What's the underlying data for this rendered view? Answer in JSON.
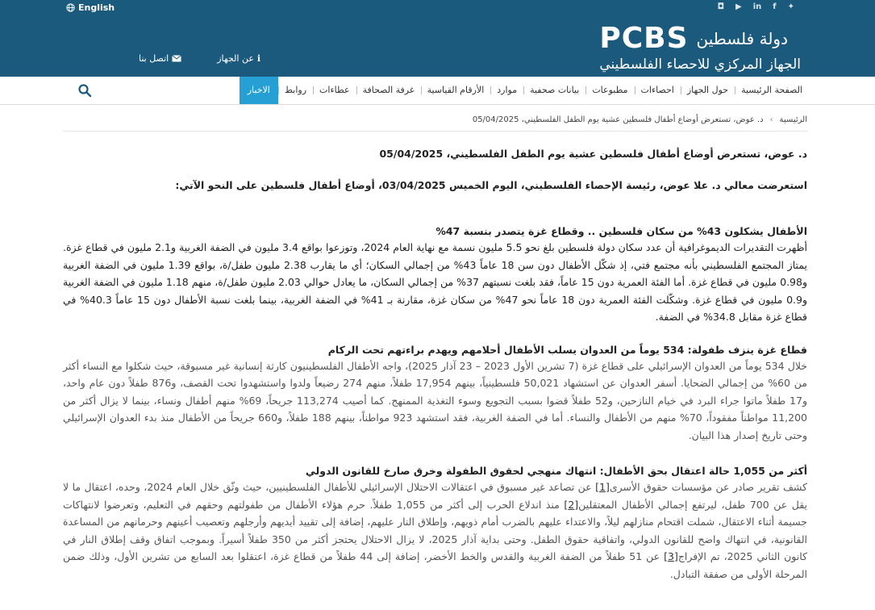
{
  "topbar": {
    "language": "English",
    "social_icons": [
      "twitter-icon",
      "facebook-icon",
      "linkedin-icon",
      "youtube-icon",
      "instagram-icon"
    ]
  },
  "header": {
    "country": "دولة فلسطين",
    "logo_text": "PCBS",
    "subtitle": "الجهاز المركزي للاحصاء الفلسطيني",
    "about": "عن الجهاز",
    "contact": "اتصل بنا"
  },
  "nav": {
    "items": [
      "الصفحة الرئيسية",
      "حول الجهاز",
      "احصاءات",
      "مطبوعات",
      "بيانات صحفية",
      "موارد",
      "الأرقام القياسية",
      "غرفة الصحافة",
      "عطاءات",
      "روابط",
      "الاخبار"
    ],
    "active_color": "#26a0d4"
  },
  "breadcrumb": {
    "home": "الرئيسية",
    "current": "د. عوض، تستعرض أوضاع أطفال فلسطين عشية يوم الطفل الفلسطيني، 05/04/2025"
  },
  "article": {
    "title": "د. عوض، تستعرض أوضاع أطفال فلسطين عشية يوم الطفل الفلسطيني، 05/04/2025",
    "lead": "استعرضت معالي د. علا عوض، رئيسة الإحصاء الفلسطيني، اليوم الخميس 03/04/2025، أوضاع أطفال فلسطين على النحو الآتي:",
    "section1_heading": "الأطفال يشكلون 43% من سكان فلسطين .. وقطاع غزة يتصدر بنسبة 47%",
    "section1_text": "أظهرت التقديرات الديموغرافية أن عدد سكان دولة فلسطين بلغ نحو 5.5 مليون نسمة مع نهاية العام 2024، وتوزعوا بواقع 3.4 مليون في الضفة الغربية و2.1 مليون في قطاع غزة.  يمتاز المجتمع الفلسطيني بأنه مجتمع فتي، إذ شكّل الأطفال دون سن 18 عاماً 43% من إجمالي السكان؛ أي ما يقارب 2.38 مليون طفل/ة،  بواقع 1.39 مليون في الضفة الغربية و0.98 مليون في قطاع غزة.  أما الفئة العمرية دون 15 عاماً، فقد بلغت نسبتهم 37% من إجمالي السكان، ما يعادل حوالي 2.03 مليون طفل/ة، منهم 1.18 مليون في الضفة الغربية و0.9 مليون في قطاع غزة.  وشكّلت الفئة العمرية دون 18 عاماً نحو 47% من سكان غزة،  مقارنة بـ 41% في الضفة الغربية، بينما بلغت نسبة الأطفال دون 15 عاماً 40.3% في قطاع غزة  مقابل 34.8% في الضفة.",
    "section2_heading": "قطاع غزة ينزف طفولة: 534 يوماً من العدوان يسلب الأطفال أحلامهم ويهدم براءتهم تحت الركام",
    "section2_text": "خلال 534 يوماً من العدوان الإسرائيلي على قطاع غزة (7 تشرين الأول 2023 – 23 آذار 2025)،  واجه الأطفال الفلسطينيون كارثة إنسانية غير مسبوقة، حيث شكلوا مع النساء أكثر من 60% من إجمالي الضحايا.  أسفر العدوان عن استشهاد 50,021 فلسطينياً، بينهم 17,954 طفلاً، منهم 274 رضيعاً ولدوا واستشهدوا تحت القصف، و876 طفلاً دون عام واحد، و17 طفلاً ماتوا جراء البرد في خيام النازحين، و52 طفلاً قضوا بسبب التجويع وسوء التغذية الممنهج. كما أصيب 113,274 جريحاً، 69% منهم أطفال ونساء، بينما لا يزال أكثر من 11,200 مواطناً مفقوداً، 70% منهم من الأطفال والنساء.   أما في الضفة الغربية، فقد استشهد 923 مواطناً، بينهم 188 طفلاً، و660 جريحاً  من الأطفال منذ بدء العدوان الإسرائيلي وحتى تاريخ إصدار هذا البيان.",
    "section3_heading": "أكثر من 1,055 حالة اعتقال بحق الأطفال: انتهاك منهجي لحقوق الطفولة وخرق صارخ للقانون الدولي",
    "section3_part1": "كشف تقرير صادر عن مؤسسات حقوق الأسرى",
    "section3_ref1": "[1]",
    "section3_part2": " عن تصاعد غير مسبوق في اعتقالات الاحتلال الإسرائيلي للأطفال الفلسطينيين، حيث وثّق خلال العام 2024، وحده، اعتقال ما لا يقل عن 700 طفل، ليرتفع إجمالي الأطفال المعتقلين",
    "section3_ref2": "[2]",
    "section3_part3": " منذ اندلاع الحرب إلى أكثر من 1,055 طفلاً.  حرم هؤلاء الأطفال من طفولتهم وحقهم في التعليم، وتعرضوا لانتهاكات جسيمة أثناء الاعتقال، شملت اقتحام منازلهم ليلاً، والاعتداء عليهم بالضرب أمام ذويهم، وإطلاق النار عليهم، إضافة إلى تقييد أيديهم وأرجلهم وتعصيب أعينهم وحرمانهم من المساعدة القانونية، في انتهاك واضح للقانون الدولي، واتفاقية حقوق الطفل.  وحتى بداية آذار 2025، لا يزال الاحتلال يحتجز أكثر من 350 طفلاً أسيراً.  وبموجب اتفاق وقف إطلاق النار في كانون الثاني 2025، تم الإفراج",
    "section3_ref3": "[3]",
    "section3_part4": " عن 51 طفلاً من الضفة الغربية والقدس والخط الأخضر، إضافة إلى 44 طفلاً من قطاع غزة، اعتقلوا بعد السابع من تشرين الأول، وذلك ضمن المرحلة الأولى من صفقة التبادل."
  }
}
